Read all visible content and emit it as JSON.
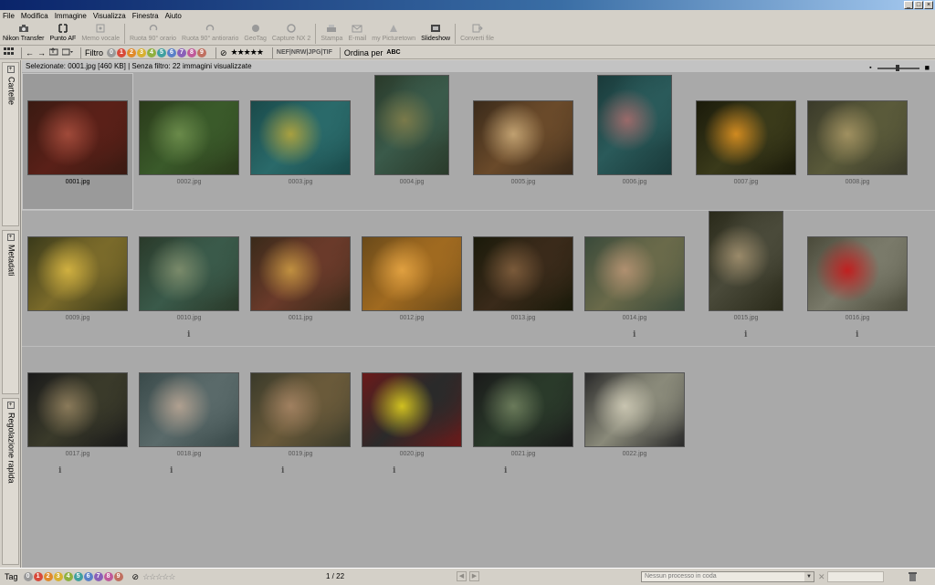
{
  "window": {
    "min": "_",
    "max": "□",
    "close": "×"
  },
  "menu": [
    "File",
    "Modifica",
    "Immagine",
    "Visualizza",
    "Finestra",
    "Aiuto"
  ],
  "toolbar": [
    {
      "label": "Nikon Transfer",
      "icon": "camera-icon",
      "enabled": true
    },
    {
      "label": "Punto AF",
      "icon": "af-point-icon",
      "enabled": true
    },
    {
      "label": "Memo vocale",
      "icon": "voice-memo-icon",
      "enabled": false
    },
    {
      "label": "Ruota 90° orario",
      "icon": "rotate-cw-icon",
      "enabled": false
    },
    {
      "label": "Ruota 90° antiorario",
      "icon": "rotate-ccw-icon",
      "enabled": false
    },
    {
      "label": "GeoTag",
      "icon": "geotag-icon",
      "enabled": false
    },
    {
      "label": "Capture NX 2",
      "icon": "capture-nx-icon",
      "enabled": false
    },
    {
      "label": "Stampa",
      "icon": "print-icon",
      "enabled": false
    },
    {
      "label": "E-mail",
      "icon": "email-icon",
      "enabled": false
    },
    {
      "label": "my Picturetown",
      "icon": "picturetown-icon",
      "enabled": false
    },
    {
      "label": "Slideshow",
      "icon": "slideshow-icon",
      "enabled": true
    },
    {
      "label": "Converti file",
      "icon": "convert-file-icon",
      "enabled": false
    }
  ],
  "filterbar": {
    "filter_label": "Filtro",
    "labels": [
      "0",
      "1",
      "2",
      "3",
      "4",
      "5",
      "6",
      "7",
      "8",
      "9"
    ],
    "label_colors": [
      "#9a9a9a",
      "#d84a3a",
      "#e08a2a",
      "#d8b030",
      "#8fb040",
      "#40a0a0",
      "#5a80c8",
      "#8a60b8",
      "#c05a9a",
      "#c07060"
    ],
    "rating_stars": "★★★★★",
    "formats": "NEF|NRW|JPG|TIF",
    "sort_label": "Ordina per",
    "sort_icon": "ABC"
  },
  "status": "Selezionate: 0001.jpg [460 KB] | Senza filtro: 22 immagini visualizzate",
  "sidebar": [
    "Cartelle",
    "Metadati",
    "Regolazione rapida"
  ],
  "thumbnails": [
    {
      "name": "0001.jpg",
      "colors": [
        "#5a2018",
        "#a04a3a",
        "#3a1a12"
      ],
      "info": false,
      "portrait": false
    },
    {
      "name": "0002.jpg",
      "colors": [
        "#3a5a2a",
        "#6a8a4a",
        "#2a3a1a"
      ],
      "info": false,
      "portrait": false
    },
    {
      "name": "0003.jpg",
      "colors": [
        "#2a6a6a",
        "#a8a040",
        "#1a4a4a"
      ],
      "info": false,
      "portrait": false
    },
    {
      "name": "0004.jpg",
      "colors": [
        "#3a5a4a",
        "#7a7a4a",
        "#2a3a2a"
      ],
      "info": false,
      "portrait": true
    },
    {
      "name": "0005.jpg",
      "colors": [
        "#6a4a2a",
        "#c0a070",
        "#3a2a1a"
      ],
      "info": false,
      "portrait": false
    },
    {
      "name": "0006.jpg",
      "colors": [
        "#2a5a5a",
        "#9a6a6a",
        "#1a3a3a"
      ],
      "info": false,
      "portrait": true
    },
    {
      "name": "0007.jpg",
      "colors": [
        "#3a3a1a",
        "#d08a20",
        "#1a1a0a"
      ],
      "info": false,
      "portrait": false
    },
    {
      "name": "0008.jpg",
      "colors": [
        "#5a5a3a",
        "#a09060",
        "#3a3a2a"
      ],
      "info": false,
      "portrait": false
    },
    {
      "name": "0009.jpg",
      "colors": [
        "#7a6a2a",
        "#d0b040",
        "#3a3a1a"
      ],
      "info": false,
      "portrait": false
    },
    {
      "name": "0010.jpg",
      "colors": [
        "#3a5a4a",
        "#7a8a6a",
        "#2a3a2a"
      ],
      "info": true,
      "portrait": false
    },
    {
      "name": "0011.jpg",
      "colors": [
        "#6a3a2a",
        "#c09040",
        "#3a2a1a"
      ],
      "info": false,
      "portrait": false
    },
    {
      "name": "0012.jpg",
      "colors": [
        "#a06a20",
        "#e0a040",
        "#6a4a1a"
      ],
      "info": false,
      "portrait": false
    },
    {
      "name": "0013.jpg",
      "colors": [
        "#3a2a1a",
        "#7a5a3a",
        "#1a1a0a"
      ],
      "info": false,
      "portrait": false
    },
    {
      "name": "0014.jpg",
      "colors": [
        "#6a6a4a",
        "#b09070",
        "#3a4a3a"
      ],
      "info": true,
      "portrait": false
    },
    {
      "name": "0015.jpg",
      "colors": [
        "#4a4a3a",
        "#9a8a6a",
        "#2a2a1a"
      ],
      "info": true,
      "portrait": true
    },
    {
      "name": "0016.jpg",
      "colors": [
        "#7a7a6a",
        "#c02020",
        "#4a4a3a"
      ],
      "info": true,
      "portrait": false
    },
    {
      "name": "0017.jpg",
      "colors": [
        "#3a3a2a",
        "#8a7a5a",
        "#1a1a1a"
      ],
      "info": true,
      "portrait": false
    },
    {
      "name": "0018.jpg",
      "colors": [
        "#5a6a6a",
        "#b0a090",
        "#3a4a4a"
      ],
      "info": true,
      "portrait": false
    },
    {
      "name": "0019.jpg",
      "colors": [
        "#6a5a3a",
        "#a08060",
        "#3a3a2a"
      ],
      "info": true,
      "portrait": false
    },
    {
      "name": "0020.jpg",
      "colors": [
        "#2a2a2a",
        "#d0c020",
        "#6a1a1a"
      ],
      "info": true,
      "portrait": false
    },
    {
      "name": "0021.jpg",
      "colors": [
        "#2a3a2a",
        "#6a7a5a",
        "#1a1a1a"
      ],
      "info": true,
      "portrait": false
    },
    {
      "name": "0022.jpg",
      "colors": [
        "#8a8a7a",
        "#c8c4b0",
        "#2a2a2a"
      ],
      "info": false,
      "portrait": false
    }
  ],
  "info_glyph": "i",
  "bottom": {
    "tag_label": "Tag",
    "count": "1 / 22",
    "queue_text": "Nessun processo in coda"
  }
}
